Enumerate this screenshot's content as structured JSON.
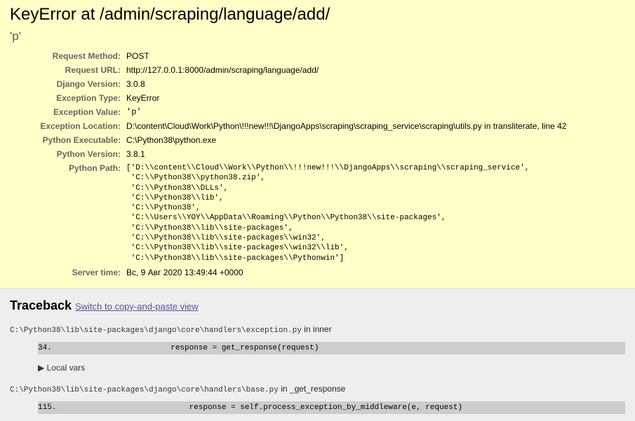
{
  "summary": {
    "title": "KeyError at /admin/scraping/language/add/",
    "exception_value_heading": "'p'",
    "meta": [
      {
        "label": "Request Method:",
        "value": "POST"
      },
      {
        "label": "Request URL:",
        "value": "http://127.0.0.1:8000/admin/scraping/language/add/"
      },
      {
        "label": "Django Version:",
        "value": "3.0.8"
      },
      {
        "label": "Exception Type:",
        "value": "KeyError"
      },
      {
        "label": "Exception Value:",
        "value": "'p'"
      },
      {
        "label": "Exception Location:",
        "value": "D:\\content\\Cloud\\Work\\Python\\!!!new!!!\\DjangoApps\\scraping\\scraping_service\\scraping\\utils.py in transliterate, line 42"
      },
      {
        "label": "Python Executable:",
        "value": "C:\\Python38\\python.exe"
      },
      {
        "label": "Python Version:",
        "value": "3.8.1"
      }
    ],
    "python_path_label": "Python Path:",
    "python_path": "['D:\\\\content\\\\Cloud\\\\Work\\\\Python\\\\!!!new!!!\\\\DjangoApps\\\\scraping\\\\scraping_service',\n 'C:\\\\Python38\\\\python38.zip',\n 'C:\\\\Python38\\\\DLLs',\n 'C:\\\\Python38\\\\lib',\n 'C:\\\\Python38',\n 'C:\\\\Users\\\\YOY\\\\AppData\\\\Roaming\\\\Python\\\\Python38\\\\site-packages',\n 'C:\\\\Python38\\\\lib\\\\site-packages',\n 'C:\\\\Python38\\\\lib\\\\site-packages\\\\win32',\n 'C:\\\\Python38\\\\lib\\\\site-packages\\\\win32\\\\lib',\n 'C:\\\\Python38\\\\lib\\\\site-packages\\\\Pythonwin']",
    "server_time_label": "Server time:",
    "server_time": "Вс, 9 Авг 2020 13:49:44 +0000"
  },
  "traceback": {
    "heading": "Traceback",
    "switch_link": "Switch to copy-and-paste view",
    "frames": [
      {
        "file": "C:\\Python38\\lib\\site-packages\\django\\core\\handlers\\exception.py",
        "in_word": "in",
        "func": "inner",
        "lineno": "34.",
        "code": "            response = get_response(request)",
        "local_vars": "▶ Local vars"
      },
      {
        "file": "C:\\Python38\\lib\\site-packages\\django\\core\\handlers\\base.py",
        "in_word": "in",
        "func": "_get_response",
        "lineno": "115.",
        "code": "                response = self.process_exception_by_middleware(e, request)"
      }
    ]
  }
}
